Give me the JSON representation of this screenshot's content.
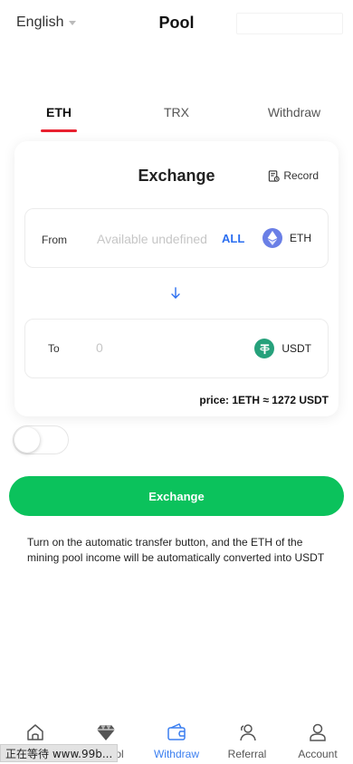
{
  "header": {
    "language": "English",
    "title": "Pool"
  },
  "tabs": [
    {
      "label": "ETH",
      "active": true
    },
    {
      "label": "TRX",
      "active": false
    },
    {
      "label": "Withdraw",
      "active": false
    }
  ],
  "exchange_card": {
    "title": "Exchange",
    "record_label": "Record",
    "from": {
      "label": "From",
      "available_text": "Available undefined",
      "all_label": "ALL",
      "coin": "ETH"
    },
    "to": {
      "label": "To",
      "value": "0",
      "coin": "USDT"
    },
    "price": "price: 1ETH ≈ 1272 USDT"
  },
  "auto_transfer_toggle": {
    "on": false
  },
  "exchange_button": "Exchange",
  "note": "Turn on the automatic transfer button, and the ETH of the mining pool income will be automatically converted into USDT",
  "tabbar": [
    {
      "label": "",
      "icon": "home-icon",
      "active": false
    },
    {
      "label": "ol",
      "icon": "diamond-icon",
      "active": false
    },
    {
      "label": "Withdraw",
      "icon": "wallet-icon",
      "active": true
    },
    {
      "label": "Referral",
      "icon": "users-icon",
      "active": false
    },
    {
      "label": "Account",
      "icon": "user-icon",
      "active": false
    }
  ],
  "status_overlay": "正在等待 www.99b...",
  "colors": {
    "accent_red": "#e8202f",
    "accent_blue": "#2b6ef0",
    "exchange_green": "#0bc25c",
    "eth_purple": "#6a7fe6",
    "usdt_green": "#26a17b"
  }
}
